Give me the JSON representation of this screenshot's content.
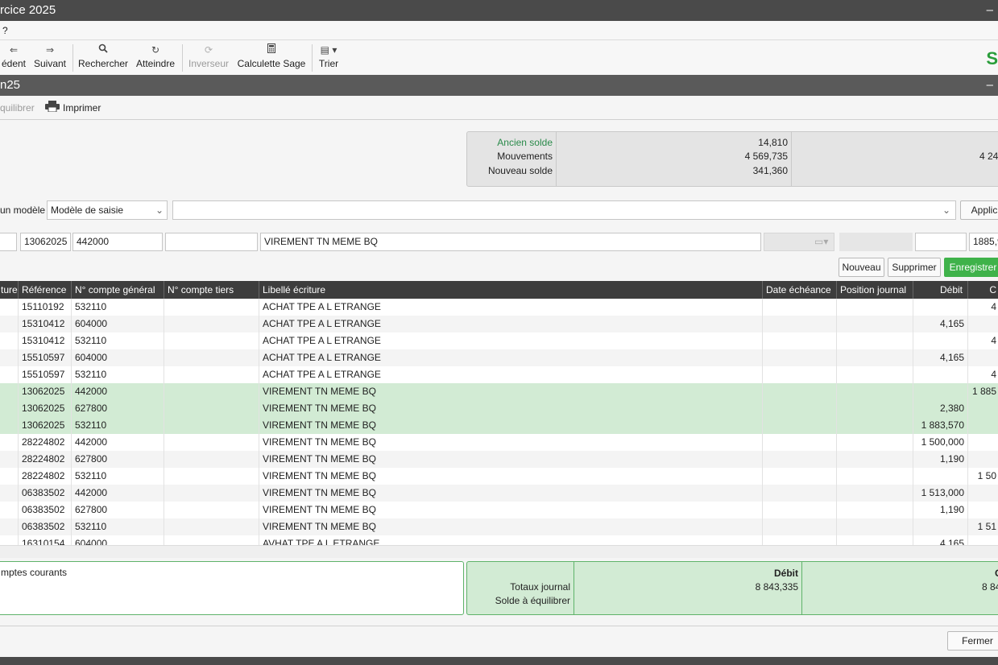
{
  "window": {
    "title": "rcice 2025",
    "min": "–"
  },
  "menu": {
    "item": "?"
  },
  "toolbar": {
    "prev": "édent",
    "next": "Suivant",
    "search": "Rechercher",
    "goto": "Atteindre",
    "invert": "Inverseur",
    "calc": "Calculette Sage",
    "sort": "Trier",
    "logo": "S"
  },
  "sub": {
    "title": "n25",
    "min": "–"
  },
  "actions": {
    "balance": "quilibrer",
    "print": "Imprimer"
  },
  "solde": {
    "labels": [
      "Ancien solde",
      "Mouvements",
      "Nouveau solde"
    ],
    "values": [
      "14,810",
      "4 569,735",
      "341,360"
    ],
    "extra": "4 24"
  },
  "model": {
    "label": "un modèle",
    "select": "Modèle de saisie",
    "apply": "Applic"
  },
  "entry": {
    "ref": "13062025",
    "account": "442000",
    "libelle": "VIREMENT TN MEME BQ",
    "amount": "1885,9"
  },
  "buttons": {
    "new": "Nouveau",
    "delete": "Supprimer",
    "save": "Enregistrer"
  },
  "columns": [
    "ture",
    "Référence",
    "N° compte général",
    "N° compte tiers",
    "Libellé écriture",
    "Date échéance",
    "Position journal",
    "Débit",
    "C"
  ],
  "rows": [
    {
      "ref": "15110192",
      "acc": "532110",
      "lib": "ACHAT TPE A L ETRANGE",
      "debit": "",
      "credit": "4"
    },
    {
      "ref": "15310412",
      "acc": "604000",
      "lib": "ACHAT TPE A L ETRANGE",
      "debit": "4,165",
      "credit": ""
    },
    {
      "ref": "15310412",
      "acc": "532110",
      "lib": "ACHAT TPE A L ETRANGE",
      "debit": "",
      "credit": "4"
    },
    {
      "ref": "15510597",
      "acc": "604000",
      "lib": "ACHAT TPE A L ETRANGE",
      "debit": "4,165",
      "credit": ""
    },
    {
      "ref": "15510597",
      "acc": "532110",
      "lib": "ACHAT TPE A L ETRANGE",
      "debit": "",
      "credit": "4"
    },
    {
      "ref": "13062025",
      "acc": "442000",
      "lib": "VIREMENT TN MEME BQ",
      "debit": "",
      "credit": "1 885"
    },
    {
      "ref": "13062025",
      "acc": "627800",
      "lib": "VIREMENT TN MEME BQ",
      "debit": "2,380",
      "credit": ""
    },
    {
      "ref": "13062025",
      "acc": "532110",
      "lib": "VIREMENT TN MEME BQ",
      "debit": "1 883,570",
      "credit": ""
    },
    {
      "ref": "28224802",
      "acc": "442000",
      "lib": "VIREMENT TN MEME BQ",
      "debit": "1 500,000",
      "credit": ""
    },
    {
      "ref": "28224802",
      "acc": "627800",
      "lib": "VIREMENT TN MEME BQ",
      "debit": "1,190",
      "credit": ""
    },
    {
      "ref": "28224802",
      "acc": "532110",
      "lib": "VIREMENT TN MEME BQ",
      "debit": "",
      "credit": "1 50"
    },
    {
      "ref": "06383502",
      "acc": "442000",
      "lib": "VIREMENT TN MEME BQ",
      "debit": "1 513,000",
      "credit": ""
    },
    {
      "ref": "06383502",
      "acc": "627800",
      "lib": "VIREMENT TN MEME BQ",
      "debit": "1,190",
      "credit": ""
    },
    {
      "ref": "06383502",
      "acc": "532110",
      "lib": "VIREMENT TN MEME BQ",
      "debit": "",
      "credit": "1 51"
    },
    {
      "ref": "16310154",
      "acc": "604000",
      "lib": "AVHAT TPE A L ETRANGE",
      "debit": "4,165",
      "credit": ""
    }
  ],
  "footer": {
    "left": "mptes courants",
    "debit_header": "Débit",
    "credit_header": "C",
    "totals_label": "Totaux journal",
    "balance_label": "Solde à équilibrer",
    "total_debit": "8 843,335",
    "total_credit": "8 84"
  },
  "close": "Fermer"
}
